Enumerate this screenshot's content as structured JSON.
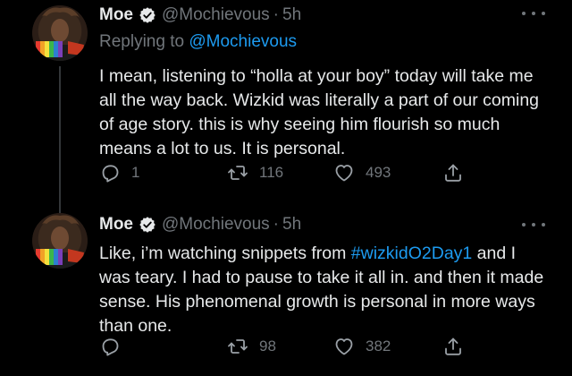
{
  "colors": {
    "background": "#000000",
    "text": "#e7e9ea",
    "muted": "#71767b",
    "link": "#1d9bf0",
    "verified": "#e7e9ea"
  },
  "tweets": [
    {
      "name": "Moe",
      "handle": "@Mochievous",
      "separator": "·",
      "time": "5h",
      "replying_prefix": "Replying to",
      "replying_to": "@Mochievous",
      "text": "I mean, listening to “holla at your boy” today will take me all the way back. Wizkid was literally a part of our coming of age story. this is why seeing him flourish so much means a lot to us. It is personal.",
      "replies": "1",
      "retweets": "116",
      "likes": "493",
      "icons": [
        "verified-badge-icon",
        "more-icon",
        "reply-icon",
        "retweet-icon",
        "like-icon",
        "share-icon"
      ]
    },
    {
      "name": "Moe",
      "handle": "@Mochievous",
      "separator": "·",
      "time": "5h",
      "text_before": "Like, i’m watching snippets from ",
      "hashtag": "#wizkidO2Day1",
      "text_after": " and I was teary. I had to pause to take it all in. and then it made sense. His phenomenal growth is personal in more ways than one.",
      "replies": "",
      "retweets": "98",
      "likes": "382",
      "icons": [
        "verified-badge-icon",
        "more-icon",
        "reply-icon",
        "retweet-icon",
        "like-icon",
        "share-icon"
      ]
    }
  ]
}
